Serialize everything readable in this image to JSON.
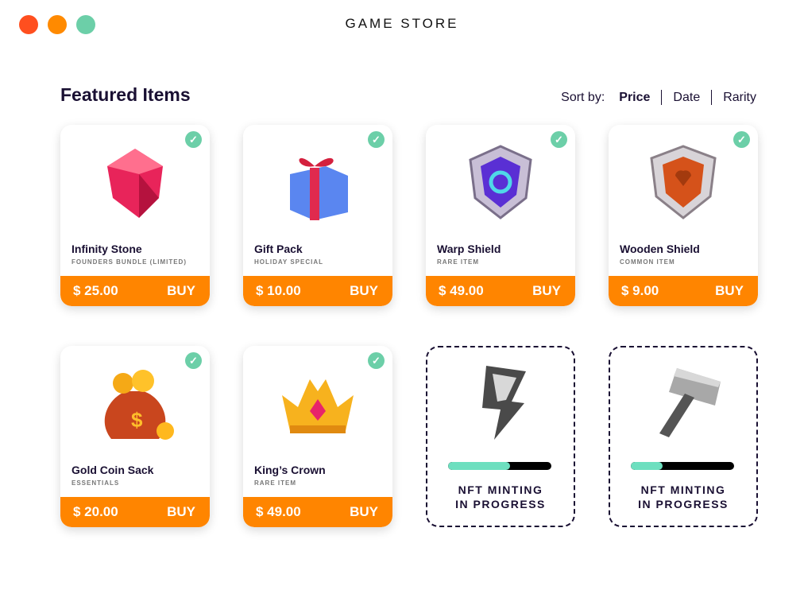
{
  "window": {
    "title": "GAME STORE",
    "controls": [
      {
        "name": "close",
        "color": "#ff4f1f"
      },
      {
        "name": "minimize",
        "color": "#ff8a00"
      },
      {
        "name": "maximize",
        "color": "#6ccfa8"
      }
    ]
  },
  "heading": "Featured Items",
  "sort": {
    "label": "Sort by:",
    "options": [
      "Price",
      "Date",
      "Rarity"
    ],
    "active": "Price"
  },
  "items": [
    {
      "name": "Infinity Stone",
      "sub": "FOUNDERS BUNDLE (LIMITED)",
      "price": "$ 25.00",
      "buy": "BUY",
      "icon": "red-gem-icon"
    },
    {
      "name": "Gift Pack",
      "sub": "HOLIDAY SPECIAL",
      "price": "$ 10.00",
      "buy": "BUY",
      "icon": "gift-box-icon"
    },
    {
      "name": "Warp Shield",
      "sub": "RARE ITEM",
      "price": "$ 49.00",
      "buy": "BUY",
      "icon": "purple-shield-icon"
    },
    {
      "name": "Wooden Shield",
      "sub": "COMMON ITEM",
      "price": "$ 9.00",
      "buy": "BUY",
      "icon": "wooden-shield-icon"
    },
    {
      "name": "Gold Coin Sack",
      "sub": "ESSENTIALS",
      "price": "$ 20.00",
      "buy": "BUY",
      "icon": "coin-sack-icon"
    },
    {
      "name": "King’s Crown",
      "sub": "RARE ITEM",
      "price": "$ 49.00",
      "buy": "BUY",
      "icon": "crown-icon"
    }
  ],
  "minting": [
    {
      "line1": "NFT MINTING",
      "line2": "IN PROGRESS",
      "progress_percent": 60,
      "icon": "lightning-rune-icon"
    },
    {
      "line1": "NFT MINTING",
      "line2": "IN PROGRESS",
      "progress_percent": 31,
      "icon": "hammer-icon"
    }
  ],
  "colors": {
    "accent": "#ff8500",
    "check": "#6ccfa8",
    "progress": "#6ddfbf"
  }
}
